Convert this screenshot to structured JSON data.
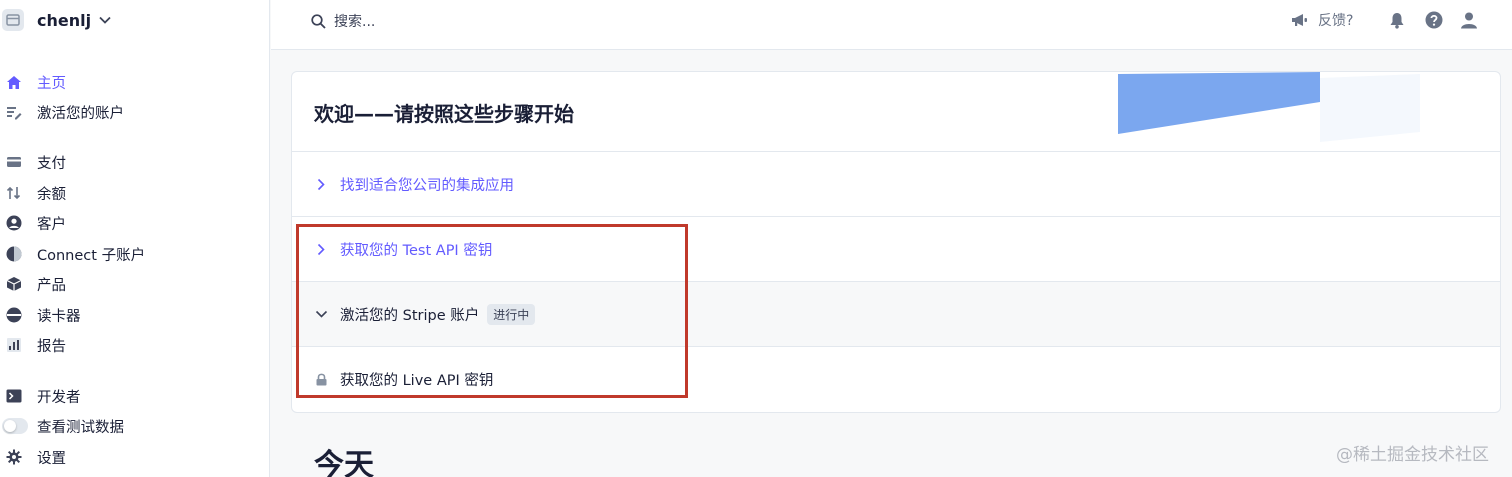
{
  "account": {
    "name": "chenlj"
  },
  "sidebar": {
    "items": [
      {
        "label": "主页",
        "icon": "home-icon",
        "active": true
      },
      {
        "label": "激活您的账户",
        "icon": "edit-list-icon"
      },
      {
        "label": "支付",
        "icon": "payments-icon"
      },
      {
        "label": "余额",
        "icon": "arrows-up-down-icon"
      },
      {
        "label": "客户",
        "icon": "customer-icon"
      },
      {
        "label": "Connect 子账户",
        "icon": "connect-icon"
      },
      {
        "label": "产品",
        "icon": "product-box-icon"
      },
      {
        "label": "读卡器",
        "icon": "card-reader-icon"
      },
      {
        "label": "报告",
        "icon": "report-chart-icon"
      },
      {
        "label": "开发者",
        "icon": "terminal-icon"
      },
      {
        "label": "查看测试数据",
        "icon": "toggle-switch"
      },
      {
        "label": "设置",
        "icon": "gear-icon"
      }
    ]
  },
  "topbar": {
    "search_placeholder": "搜索...",
    "feedback_label": "反馈?"
  },
  "card": {
    "title": "欢迎——请按照这些步骤开始",
    "steps": [
      {
        "label": "找到适合您公司的集成应用",
        "state": "collapsed",
        "icon": "chevron-right-icon"
      },
      {
        "label": "获取您的 Test API 密钥",
        "state": "collapsed",
        "icon": "chevron-right-icon"
      },
      {
        "label": "激活您的 Stripe 账户",
        "state": "expanded",
        "icon": "chevron-down-icon",
        "badge": "进行中"
      },
      {
        "label": "获取您的 Live API 密钥",
        "state": "locked",
        "icon": "lock-icon"
      }
    ]
  },
  "section_title": "今天",
  "watermark": "@稀土掘金技术社区",
  "colors": {
    "accent": "#635bff",
    "highlight_border": "#c0392b",
    "deco_blue": "#7ba7ef"
  }
}
